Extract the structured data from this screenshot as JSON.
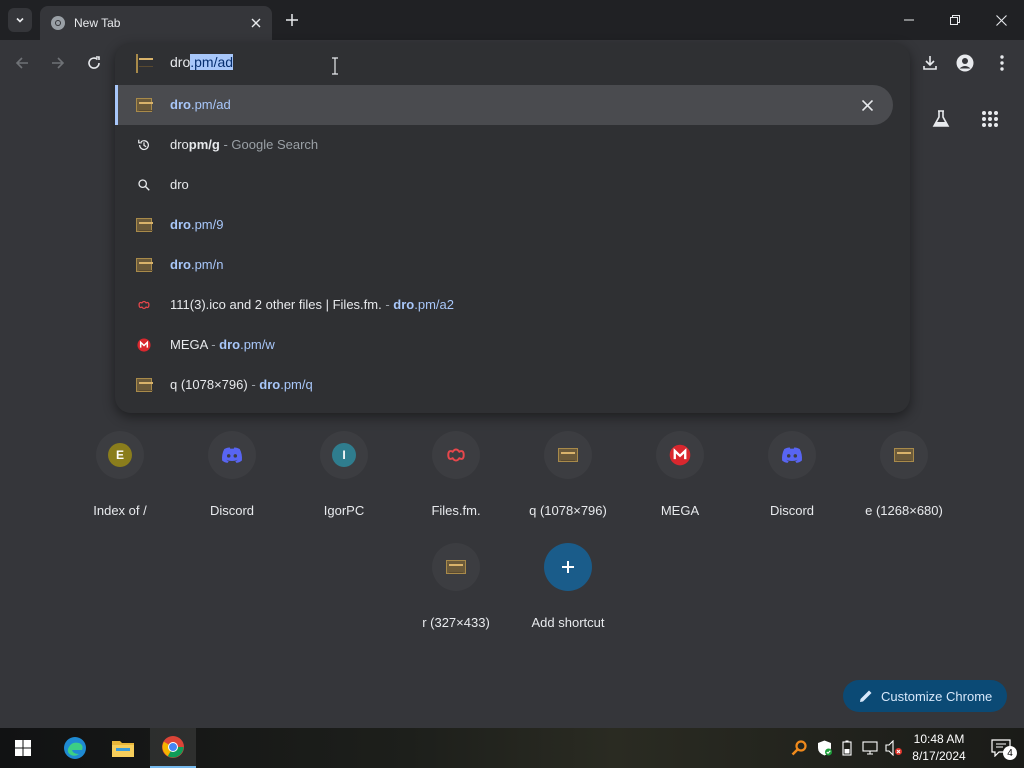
{
  "browser": {
    "tab": {
      "title": "New Tab"
    },
    "colors": {
      "accent": "#a8c7fa",
      "frame": "#202124",
      "toolbar": "#35363a"
    }
  },
  "omnibox": {
    "typed": "dro",
    "autocomplete": ".pm/ad",
    "suggestions": [
      {
        "icon": "image-favicon-icon",
        "parts": [
          {
            "t": "dro",
            "b": true,
            "url": true
          },
          {
            "t": ".pm/ad",
            "url": true
          }
        ]
      },
      {
        "icon": "history-icon",
        "parts": [
          {
            "t": "dro"
          },
          {
            "t": "pm/g",
            "b": true
          },
          {
            "t": " - Google Search",
            "dim": true
          }
        ]
      },
      {
        "icon": "search-icon",
        "parts": [
          {
            "t": "dro"
          }
        ]
      },
      {
        "icon": "image-favicon-icon",
        "parts": [
          {
            "t": "dro",
            "b": true,
            "url": true
          },
          {
            "t": ".pm/9",
            "url": true
          }
        ]
      },
      {
        "icon": "image-favicon-icon",
        "parts": [
          {
            "t": "dro",
            "b": true,
            "url": true
          },
          {
            "t": ".pm/n",
            "url": true
          }
        ]
      },
      {
        "icon": "filesfm-icon",
        "parts": [
          {
            "t": "111(3).ico and 2 other files | Files.fm."
          },
          {
            "t": " - ",
            "dim": true
          },
          {
            "t": "dro",
            "b": true,
            "url": true
          },
          {
            "t": ".pm/a2",
            "url": true
          }
        ]
      },
      {
        "icon": "mega-icon",
        "parts": [
          {
            "t": "MEGA"
          },
          {
            "t": " - ",
            "dim": true
          },
          {
            "t": "dro",
            "b": true,
            "url": true
          },
          {
            "t": ".pm/w",
            "url": true
          }
        ]
      },
      {
        "icon": "image-favicon-icon",
        "parts": [
          {
            "t": "q (1078×796)"
          },
          {
            "t": " - ",
            "dim": true
          },
          {
            "t": "dro",
            "b": true,
            "url": true
          },
          {
            "t": ".pm/q",
            "url": true
          }
        ]
      }
    ]
  },
  "shortcuts": [
    {
      "label": "Index of /",
      "icon": "letter-e-icon",
      "letter": "E",
      "color": "#8a7d1c"
    },
    {
      "label": "Discord",
      "icon": "discord-icon"
    },
    {
      "label": "IgorPC",
      "icon": "letter-i-icon",
      "letter": "I",
      "color": "#2f7d8e"
    },
    {
      "label": "Files.fm.",
      "icon": "filesfm-icon"
    },
    {
      "label": "q (1078×796)",
      "icon": "image-favicon-icon"
    },
    {
      "label": "MEGA",
      "icon": "mega-icon"
    },
    {
      "label": "Discord",
      "icon": "discord-icon"
    },
    {
      "label": "e (1268×680)",
      "icon": "image-favicon-icon"
    },
    {
      "label": "r (327×433)",
      "icon": "image-favicon-icon"
    },
    {
      "label": "Add shortcut",
      "icon": "plus-icon"
    }
  ],
  "customize": {
    "label": "Customize Chrome"
  },
  "taskbar": {
    "time": "10:48 AM",
    "date": "8/17/2024",
    "notifications": "4"
  }
}
